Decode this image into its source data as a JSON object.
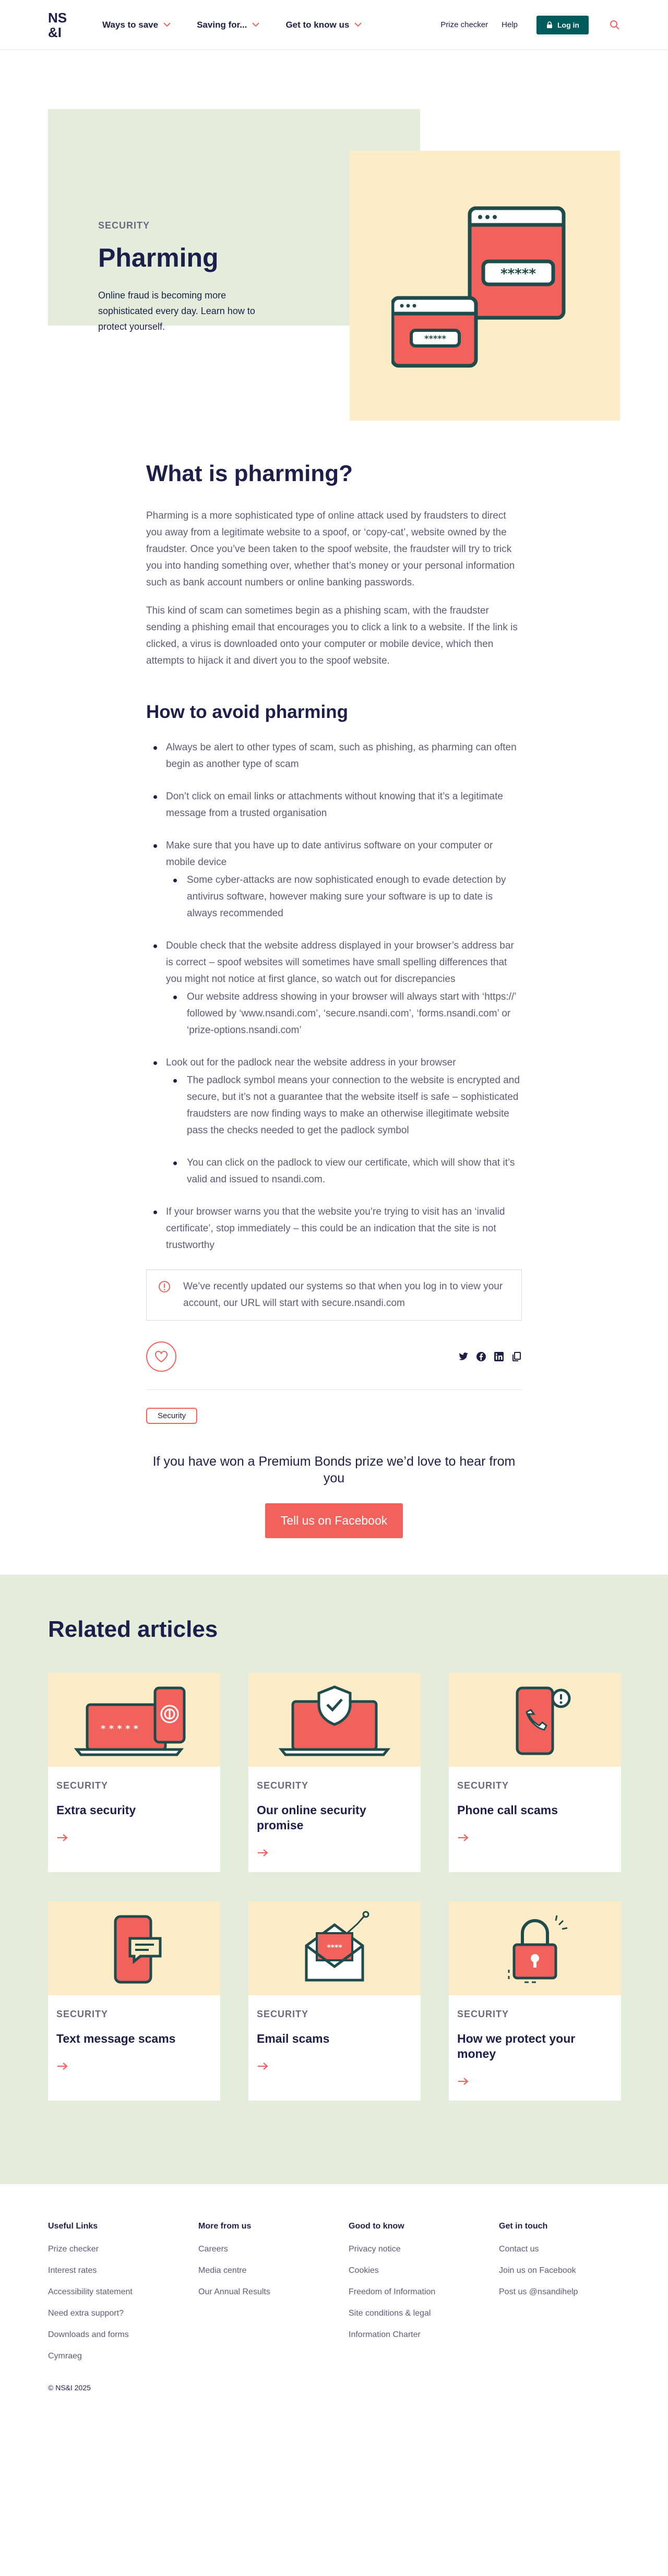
{
  "header": {
    "nav": [
      "Ways to save",
      "Saving for...",
      "Get to know us"
    ],
    "utility": {
      "prize_checker": "Prize checker",
      "help": "Help",
      "login": "Log in"
    }
  },
  "hero": {
    "eyebrow": "SECURITY",
    "title": "Pharming",
    "subtitle": "Online fraud is becoming more sophisticated every day. Learn how to protect yourself."
  },
  "article": {
    "heading": "What is pharming?",
    "paragraphs": [
      "Pharming is a more sophisticated type of online attack used by fraudsters to direct you away from a legitimate website to a spoof, or ‘copy-cat’, website owned by the fraudster. Once you’ve been taken to the spoof website, the fraudster will try to trick you into handing something over, whether that’s money or your personal information such as bank account numbers or online banking passwords.",
      "This kind of scam can sometimes begin as a phishing scam, with the fraudster sending a phishing email that encourages you to click a link to a website. If the link is clicked, a virus is downloaded onto your computer or mobile device, which then attempts to hijack it and divert you to the spoof website."
    ],
    "avoid_heading": "How to avoid pharming",
    "bullets": [
      "Always be alert to other types of scam, such as phishing, as pharming can often begin as another type of scam",
      "Don’t click on email links or attachments without knowing that it’s a legitimate message from a trusted organisation",
      "Make sure that you have up to date antivirus software on your computer or mobile device",
      "Double check that the website address displayed in your browser’s address bar is correct – spoof websites will sometimes have small spelling differences that you might not notice at first glance, so watch out for discrepancies",
      "Look out for the padlock near the website address in your browser",
      "If your browser warns you that the website you’re trying to visit has an ‘invalid certificate’, stop immediately – this could be an indication that the site is not trustworthy"
    ],
    "sub_bullets": {
      "antivirus": "Some cyber-attacks are now sophisticated enough to evade detection by antivirus software, however making sure your software is up to date is always recommended",
      "address": "Our website address showing in your browser will always start with ‘https://’ followed by ‘www.nsandi.com’, ‘secure.nsandi.com’, ‘forms.nsandi.com’ or ‘prize-options.nsandi.com’",
      "padlock_1": "The padlock symbol means your connection to the website is encrypted and secure, but it’s not a guarantee that the website itself is safe – sophisticated fraudsters are now finding ways to make an otherwise illegitimate website pass the checks needed to get the padlock symbol",
      "padlock_2": "You can click on the padlock to view our certificate, which will show that it’s valid and issued to nsandi.com."
    },
    "notice": "We’ve recently updated our systems so that when you log in to view your account, our URL will start with secure.nsandi.com",
    "tag": "Security",
    "cta_text": "If you have won a Premium Bonds prize we’d love to hear from you",
    "cta_button": "Tell us on Facebook"
  },
  "related": {
    "heading": "Related articles",
    "cards": [
      {
        "category": "SECURITY",
        "title": "Extra security",
        "icon": "laptop-fingerprint-icon"
      },
      {
        "category": "SECURITY",
        "title": "Our online security promise",
        "icon": "laptop-shield-icon"
      },
      {
        "category": "SECURITY",
        "title": "Phone call scams",
        "icon": "phone-call-alert-icon"
      },
      {
        "category": "SECURITY",
        "title": "Text message scams",
        "icon": "phone-message-icon"
      },
      {
        "category": "SECURITY",
        "title": "Email scams",
        "icon": "envelope-hook-icon"
      },
      {
        "category": "SECURITY",
        "title": "How we protect your money",
        "icon": "padlock-icon"
      }
    ]
  },
  "footer": {
    "columns": [
      {
        "heading": "Useful Links",
        "links": [
          "Prize checker",
          "Interest rates",
          "Accessibility statement",
          "Need extra support?",
          "Downloads and forms",
          "Cymraeg"
        ]
      },
      {
        "heading": "More from us",
        "links": [
          "Careers",
          "Media centre",
          "Our Annual Results"
        ]
      },
      {
        "heading": "Good to know",
        "links": [
          "Privacy notice",
          "Cookies",
          "Freedom of Information",
          "Site conditions & legal",
          "Information Charter"
        ]
      },
      {
        "heading": "Get in touch",
        "links": [
          "Contact us",
          "Join us on Facebook",
          "Post us @nsandihelp"
        ]
      }
    ],
    "copyright": "© NS&I 2025"
  },
  "colors": {
    "navy": "#1e1e4b",
    "coral": "#f2625d",
    "teal": "#005c5c",
    "sage": "#e4eddb",
    "cream": "#fdecc8"
  }
}
